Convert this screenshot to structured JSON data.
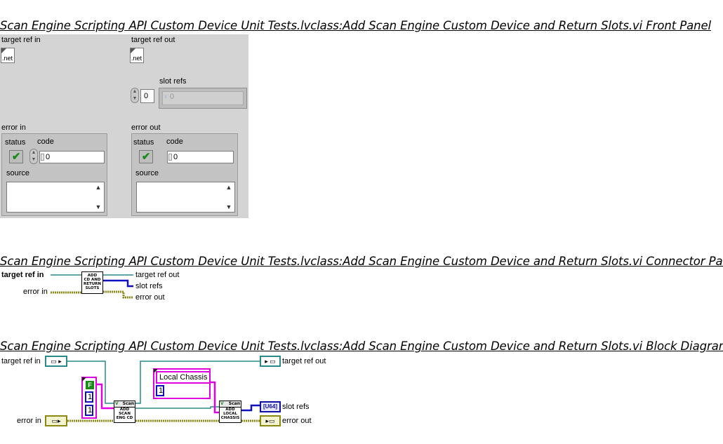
{
  "headings": {
    "front_panel": "Scan Engine Scripting API Custom Device Unit Tests.lvclass:Add Scan Engine Custom Device and Return Slots.vi Front Panel",
    "connector_pane": "Scan Engine Scripting API Custom Device Unit Tests.lvclass:Add Scan Engine Custom Device and Return Slots.vi Connector Pane",
    "block_diagram": "Scan Engine Scripting API Custom Device Unit Tests.lvclass:Add Scan Engine Custom Device and Return Slots.vi Block Diagram"
  },
  "front_panel": {
    "target_ref_in": {
      "label": "target ref in",
      "icon_text": ".net"
    },
    "target_ref_out": {
      "label": "target ref out",
      "icon_text": ".net"
    },
    "slot_refs": {
      "label": "slot refs",
      "index_value": "0",
      "element_value": "0"
    },
    "error_in": {
      "label": "error in",
      "status_label": "status",
      "code_label": "code",
      "code_value": "0",
      "source_label": "source",
      "source_value": ""
    },
    "error_out": {
      "label": "error out",
      "status_label": "status",
      "code_label": "code",
      "code_value": "0",
      "source_label": "source",
      "source_value": ""
    }
  },
  "connector_pane": {
    "inputs": [
      "target ref in",
      "error in"
    ],
    "outputs": [
      "target ref out",
      "slot refs",
      "error out"
    ],
    "icon_lines": [
      "ADD",
      "CD AND",
      "RETURN",
      "SLOTS"
    ]
  },
  "block_diagram": {
    "terminals": {
      "target_ref_in": "target ref in",
      "error_in": "error in",
      "target_ref_out": "target ref out",
      "slot_refs": "slot refs",
      "error_out": "error out"
    },
    "string_constant": "Local Chassis",
    "numeric_constant_chassis": "1",
    "cluster_constant": {
      "bool": "F",
      "values": [
        "1",
        "1"
      ]
    },
    "subvi_add_scan_eng_cd": {
      "header": "Scan",
      "lines": [
        "ADD",
        "SCAN",
        "ENG CD"
      ]
    },
    "subvi_add_local_chassis": {
      "header": "Scan",
      "lines": [
        "ADD",
        "LOCAL",
        "CHASSIS"
      ]
    },
    "u64_terminal_text": "[U64]"
  },
  "colors": {
    "panel_bg": "#d4d4d4",
    "refnum_wire": "#2a8a8a",
    "error_wire": "#8a8a10",
    "u64_wire": "#1010c0",
    "string_wire": "#e000e0"
  }
}
